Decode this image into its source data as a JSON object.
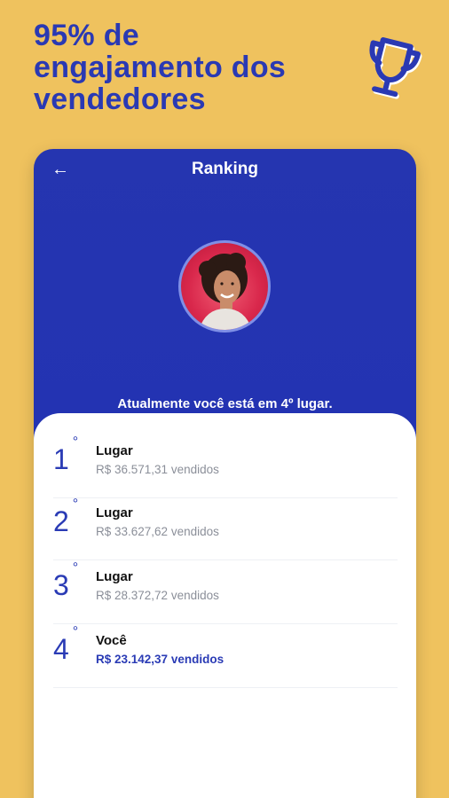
{
  "headline": {
    "line1": "95% de",
    "line2": "engajamento dos",
    "line3": "vendedores"
  },
  "icons": {
    "trophy": "trophy-icon",
    "back": "back-arrow-icon"
  },
  "screen": {
    "title": "Ranking",
    "back_label": "←",
    "status": "Atualmente você está em 4º lugar."
  },
  "ranking": [
    {
      "position": "1",
      "suffix": "°",
      "label": "Lugar",
      "sales": "R$ 36.571,31 vendidos"
    },
    {
      "position": "2",
      "suffix": "°",
      "label": "Lugar",
      "sales": "R$ 33.627,62 vendidos"
    },
    {
      "position": "3",
      "suffix": "°",
      "label": "Lugar",
      "sales": "R$ 28.372,72 vendidos"
    },
    {
      "position": "4",
      "suffix": "°",
      "label": "Você",
      "sales": "R$ 23.142,37 vendidos"
    }
  ],
  "colors": {
    "background": "#efc25e",
    "brand_blue": "#2a39b3",
    "card_blue": "#2232b3"
  }
}
